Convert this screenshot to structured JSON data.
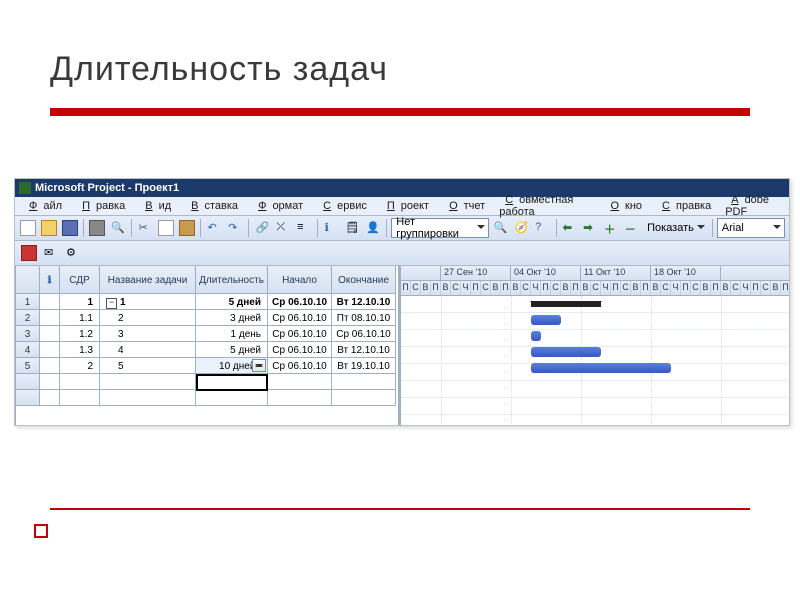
{
  "slide": {
    "title": "Длительность задач"
  },
  "app": {
    "titlebar": "Microsoft Project - Проект1",
    "menus": [
      "Файл",
      "Правка",
      "Вид",
      "Вставка",
      "Формат",
      "Сервис",
      "Проект",
      "Отчет",
      "Совместная работа",
      "Окно",
      "Справка",
      "Adobe PDF"
    ],
    "group_combo": "Нет группировки",
    "show_label": "Показать",
    "font_combo": "Arial"
  },
  "grid": {
    "columns": [
      "",
      "",
      "СДР",
      "Название задачи",
      "Длительность",
      "Начало",
      "Окончание"
    ],
    "rows": [
      {
        "n": "1",
        "wbs": "1",
        "name": "1",
        "dur": "5 дней",
        "start": "Ср 06.10.10",
        "end": "Вт 12.10.10",
        "summary": true
      },
      {
        "n": "2",
        "wbs": "1.1",
        "name": "2",
        "dur": "3 дней",
        "start": "Ср 06.10.10",
        "end": "Пт 08.10.10",
        "summary": false
      },
      {
        "n": "3",
        "wbs": "1.2",
        "name": "3",
        "dur": "1 день",
        "start": "Ср 06.10.10",
        "end": "Ср 06.10.10",
        "summary": false
      },
      {
        "n": "4",
        "wbs": "1.3",
        "name": "4",
        "dur": "5 дней",
        "start": "Ср 06.10.10",
        "end": "Вт 12.10.10",
        "summary": false
      },
      {
        "n": "5",
        "wbs": "2",
        "name": "5",
        "dur": "10 дней?",
        "start": "Ср 06.10.10",
        "end": "Вт 19.10.10",
        "summary": false,
        "editing": true
      }
    ]
  },
  "timeline": {
    "weeks": [
      "",
      "27 Сен '10",
      "04 Окт '10",
      "11 Окт '10",
      "18 Окт '10"
    ],
    "day_letters": [
      "П",
      "С",
      "В",
      "П",
      "В",
      "С",
      "Ч"
    ],
    "origin_days_before_first_week": 4
  },
  "gantt_bars": [
    {
      "row": 0,
      "start": "2010-10-06",
      "end": "2010-10-12",
      "type": "summary"
    },
    {
      "row": 1,
      "start": "2010-10-06",
      "end": "2010-10-08",
      "type": "task"
    },
    {
      "row": 2,
      "start": "2010-10-06",
      "end": "2010-10-06",
      "type": "task"
    },
    {
      "row": 3,
      "start": "2010-10-06",
      "end": "2010-10-12",
      "type": "task"
    },
    {
      "row": 4,
      "start": "2010-10-06",
      "end": "2010-10-19",
      "type": "task"
    }
  ]
}
